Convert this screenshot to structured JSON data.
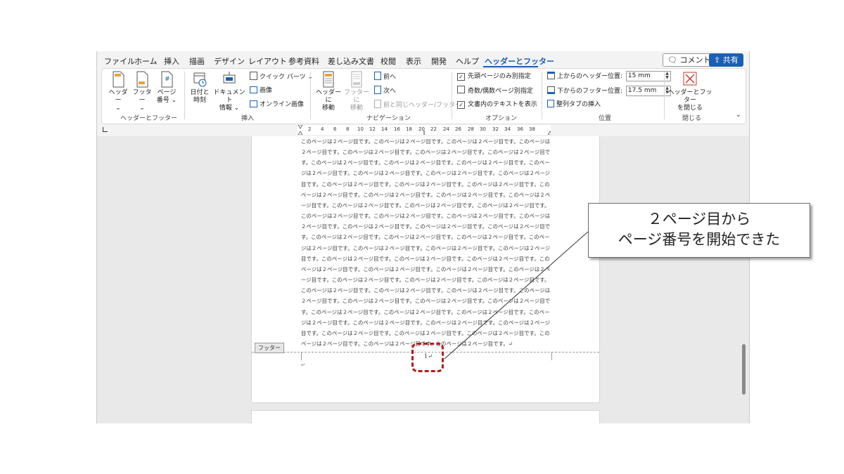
{
  "menu": {
    "tabs": [
      "ファイル",
      "ホーム",
      "挿入",
      "描画",
      "デザイン",
      "レイアウト",
      "参考資料",
      "差し込み文書",
      "校閲",
      "表示",
      "開発",
      "ヘルプ",
      "ヘッダーとフッター"
    ],
    "active_tab": "ヘッダーとフッター",
    "comment_label": "コメント",
    "share_label": "共有",
    "accent_color": "#1a5fb4"
  },
  "ribbon": {
    "group_header_footer": {
      "label": "ヘッダーとフッター",
      "header": "ヘッダー",
      "footer": "フッター",
      "page_number_line1": "ページ",
      "page_number_line2": "番号"
    },
    "group_insert": {
      "label": "挿入",
      "date_time_line1": "日付と",
      "date_time_line2": "時刻",
      "doc_info_line1": "ドキュメント",
      "doc_info_line2": "情報",
      "quick_parts": "クイック パーツ",
      "picture": "画像",
      "online_picture": "オンライン画像"
    },
    "group_navigation": {
      "label": "ナビゲーション",
      "goto_header_line1": "ヘッダーに",
      "goto_header_line2": "移動",
      "goto_footer_line1": "フッターに",
      "goto_footer_line2": "移動",
      "previous": "前へ",
      "next": "次へ",
      "link_to_previous": "前と同じヘッダー/フッター"
    },
    "group_options": {
      "label": "オプション",
      "different_first_page": "先頭ページのみ別指定",
      "different_first_page_checked": true,
      "different_odd_even": "奇数/偶数ページ別指定",
      "different_odd_even_checked": false,
      "show_doc_text": "文書内のテキストを表示",
      "show_doc_text_checked": true
    },
    "group_position": {
      "label": "位置",
      "header_from_top_label": "上からのヘッダー位置:",
      "header_from_top_value": "15 mm",
      "footer_from_bottom_label": "下からのフッター位置:",
      "footer_from_bottom_value": "17.5 mm",
      "insert_alignment_tab": "整列タブの挿入"
    },
    "group_close": {
      "label": "閉じる",
      "close_line1": "ヘッダーとフッター",
      "close_line2": "を閉じる"
    }
  },
  "ruler": {
    "ticks": [
      "2",
      "4",
      "6",
      "8",
      "10",
      "12",
      "14",
      "16",
      "18",
      "20",
      "22",
      "24",
      "26",
      "28",
      "30",
      "32",
      "34",
      "36",
      "38"
    ]
  },
  "document": {
    "body_text": "このページは２ページ目です。このページは２ページ目です。このページは２ページ目です。このページは２ページ目です。このページは２ページ目です。このページは２ページ目です。このページは２ページ目です。このページは２ページ目です。このページは２ページ目です。このページは２ページ目です。このページは２ページ目です。このページは２ページ目です。このページは２ページ目です。このページは２ページ目です。このページは２ページ目です。このページは２ページ目です。このページは２ページ目です。このページは２ページ目です。このページは２ページ目です。このページは２ページ目です。このページは２ページ目です。このページは２ページ目です。このページは２ページ目です。このページは２ページ目です。このページは２ページ目です。このページは２ページ目です。このページは２ページ目です。このページは２ページ目です。このページは２ページ目です。このページは２ページ目です。このページは２ページ目です。このページは２ページ目です。このページは２ページ目です。このページは２ページ目です。このページは２ページ目です。このページは２ページ目です。このページは２ページ目です。このページは２ページ目です。このページは２ページ目です。このページは２ページ目です。このページは２ページ目です。このページは２ページ目です。このページは２ページ目です。このページは２ページ目です。このページは２ページ目です。このページは２ページ目です。このページは２ページ目です。このページは２ページ目です。このページは２ページ目です。このページは２ページ目です。このページは２ページ目です。このページは２ページ目です。このページは２ページ目です。このページは２ページ目です。このページは２ページ目です。このページは２ページ目です。このページは２ページ目です。このページは２ページ目です。このページは２ページ目です。このページは２ページ目です。このページは２ページ目です。このページは２ページ目です。このページは２ページ目です。このページは２ページ目です。このページは２ページ目です。このページは２ページ目です。このページは２ページ目です。このページは２ページ目です。↵",
    "footer_label": "フッター",
    "page_number": "1↵",
    "paragraph_mark": "↵"
  },
  "annotation": {
    "callout_line1": "２ページ目から",
    "callout_line2": "ページ番号を開始できた",
    "highlight_color": "#b01d1d"
  }
}
